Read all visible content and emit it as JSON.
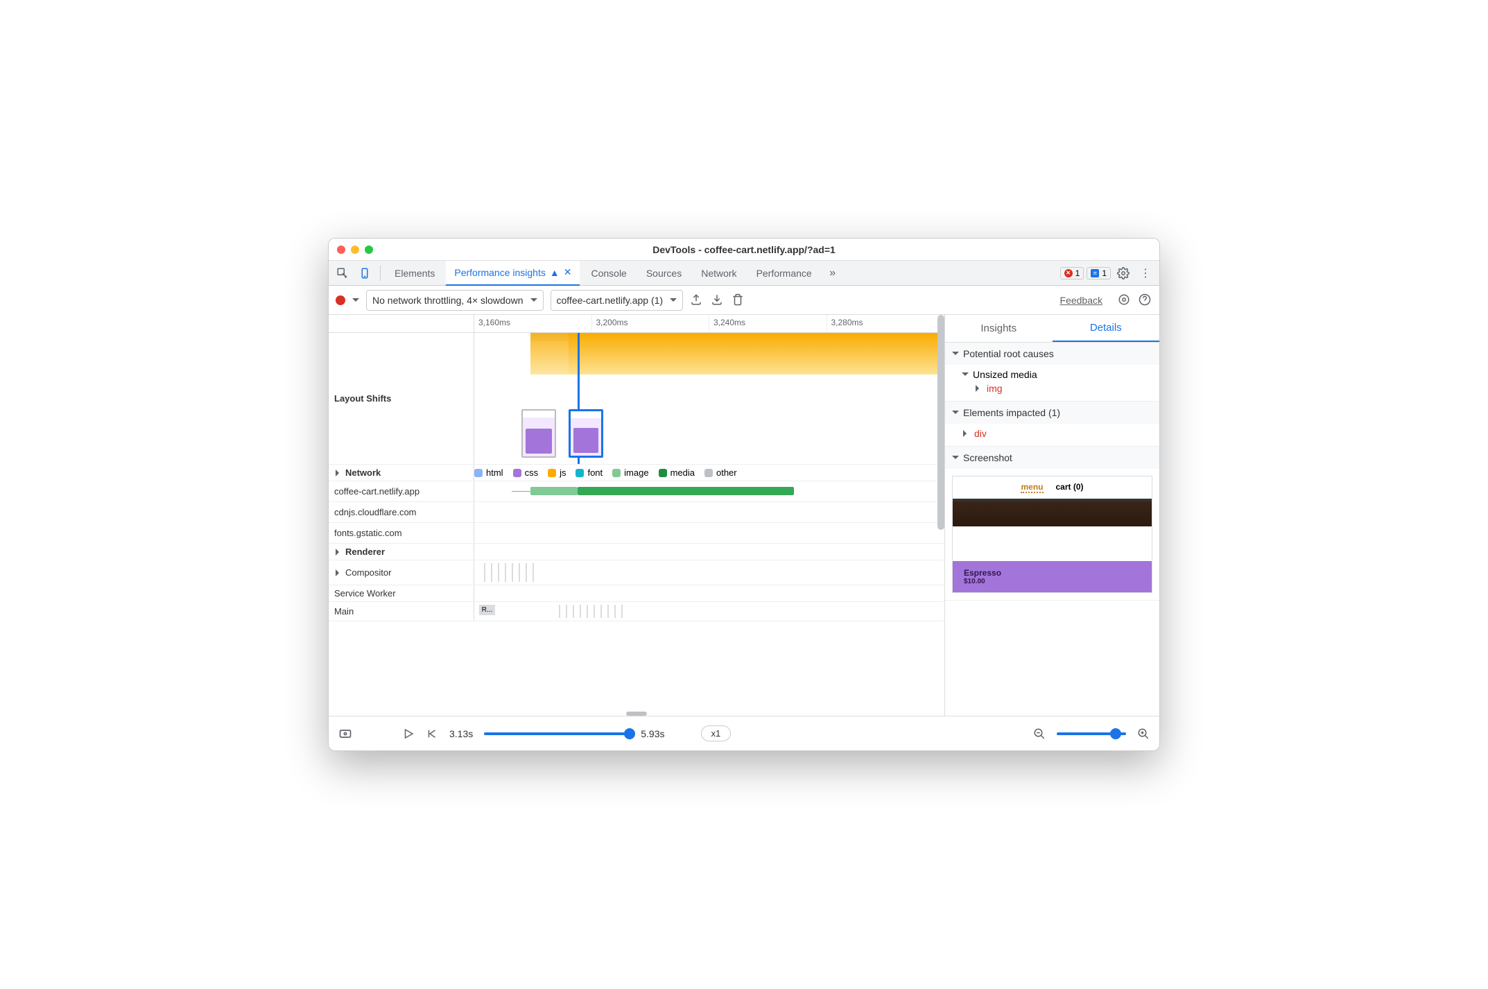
{
  "window": {
    "title": "DevTools - coffee-cart.netlify.app/?ad=1"
  },
  "tabs": {
    "elements": "Elements",
    "perf_insights": "Performance insights",
    "console": "Console",
    "sources": "Sources",
    "network": "Network",
    "performance": "Performance",
    "error_count": "1",
    "message_count": "1"
  },
  "toolbar": {
    "throttle": "No network throttling, 4× slowdown",
    "page_select": "coffee-cart.netlify.app (1)",
    "feedback": "Feedback"
  },
  "ruler": {
    "t1": "3,160ms",
    "t2": "3,200ms",
    "t3": "3,240ms",
    "t4": "3,280ms"
  },
  "tracks": {
    "layout_shifts": "Layout Shifts",
    "network": "Network",
    "renderer": "Renderer",
    "compositor": "Compositor",
    "service_worker": "Service Worker",
    "main": "Main",
    "main_block": "R...",
    "hosts": {
      "h1": "coffee-cart.netlify.app",
      "h2": "cdnjs.cloudflare.com",
      "h3": "fonts.gstatic.com"
    }
  },
  "legend": {
    "html": "html",
    "css": "css",
    "js": "js",
    "font": "font",
    "image": "image",
    "media": "media",
    "other": "other"
  },
  "side": {
    "tab_insights": "Insights",
    "tab_details": "Details",
    "root_causes": "Potential root causes",
    "unsized_media": "Unsized media",
    "img": "img",
    "elements_impacted": "Elements impacted (1)",
    "div": "div",
    "screenshot": "Screenshot",
    "shot": {
      "menu": "menu",
      "cart": "cart (0)",
      "item": "Espresso",
      "price": "$10.00"
    }
  },
  "footer": {
    "start": "3.13s",
    "end": "5.93s",
    "speed": "x1"
  },
  "colors": {
    "html": "#8ab4f8",
    "css": "#a374d9",
    "js": "#f9ab00",
    "font": "#12b5cb",
    "image": "#81c995",
    "media": "#1e8e3e",
    "other": "#bdc1c6"
  }
}
